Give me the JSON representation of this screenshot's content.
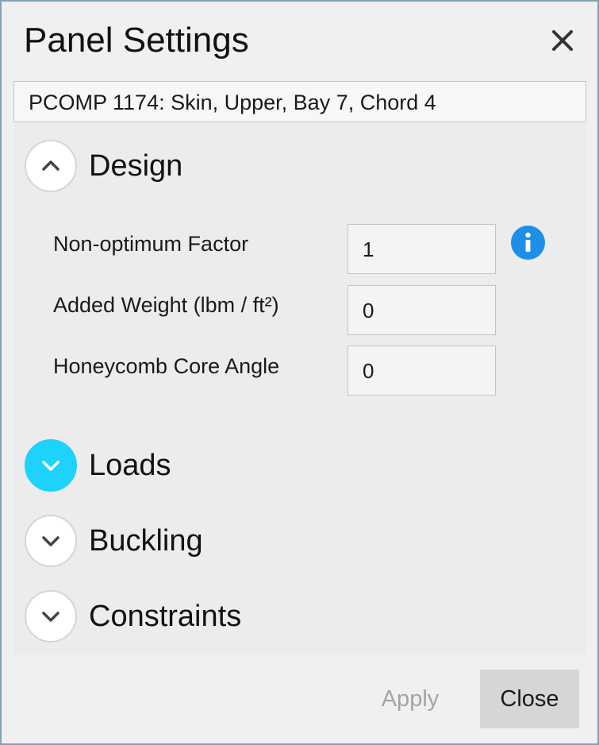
{
  "window": {
    "title": "Panel Settings",
    "close_icon": "close-icon"
  },
  "panel_name": "PCOMP 1174: Skin, Upper, Bay 7, Chord 4",
  "sections": {
    "design": {
      "label": "Design",
      "expanded": true,
      "fields": [
        {
          "label": "Non-optimum Factor",
          "value": "1"
        },
        {
          "label": "Added Weight (lbm / ft²)",
          "value": "0"
        },
        {
          "label": "Honeycomb Core Angle",
          "value": "0"
        }
      ]
    },
    "loads": {
      "label": "Loads",
      "expanded": false
    },
    "buckling": {
      "label": "Buckling",
      "expanded": false
    },
    "constraints": {
      "label": "Constraints",
      "expanded": false
    }
  },
  "footer": {
    "apply_label": "Apply",
    "close_label": "Close"
  },
  "colors": {
    "accent_toggle": "#1ed3fb",
    "info_icon": "#1e8fe6",
    "window_border": "#7fa3b8"
  }
}
